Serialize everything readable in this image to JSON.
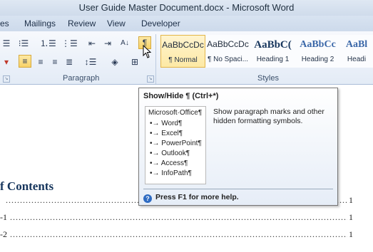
{
  "window": {
    "title": "User Guide Master Document.docx - Microsoft Word"
  },
  "tabs": [
    "es",
    "Mailings",
    "Review",
    "View",
    "Developer"
  ],
  "ribbon": {
    "paragraph_label": "Paragraph",
    "styles_label": "Styles",
    "show_hide_glyph": "¶",
    "sort_glyph": "A↓",
    "styles": [
      {
        "preview": "AaBbCcDc",
        "name": "¶ Normal",
        "selected": true
      },
      {
        "preview": "AaBbCcDc",
        "name": "¶ No Spaci..."
      },
      {
        "preview": "AaBbC(",
        "name": "Heading 1"
      },
      {
        "preview": "AaBbCc",
        "name": "Heading 2"
      },
      {
        "preview": "AaBl",
        "name": "Headi"
      }
    ]
  },
  "tooltip": {
    "title": "Show/Hide ¶ (Ctrl+*)",
    "description": "Show paragraph marks and other hidden formatting symbols.",
    "preview_header": "Microsoft·Office¶",
    "preview_items": [
      "Word¶",
      "Excel¶",
      "PowerPoint¶",
      "Outlook¶",
      "Access¶",
      "InfoPath¶"
    ],
    "help_text": "Press F1 for more help."
  },
  "document": {
    "toc_title": "f Contents",
    "toc_lines": [
      {
        "lead": "",
        "page": "1"
      },
      {
        "lead": "-1",
        "page": "1"
      },
      {
        "lead": "-2",
        "page": "1"
      }
    ]
  },
  "colors": {
    "accent": "#17365d",
    "highlight": "#f8d267",
    "help_icon": "#2e6bc2"
  }
}
